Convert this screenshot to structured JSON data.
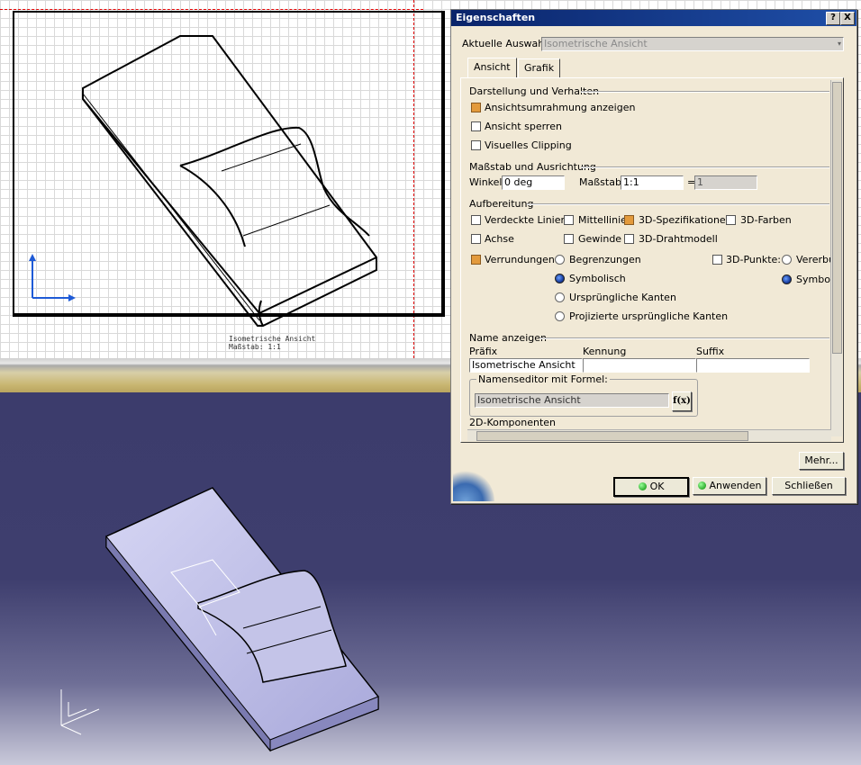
{
  "drawing": {
    "caption_line1": "Isometrische Ansicht",
    "caption_line2": "Maßstab:  1:1"
  },
  "dialog": {
    "title": "Eigenschaften",
    "help_button": "?",
    "close_button": "X",
    "current_selection_label": "Aktuelle Auswahl:",
    "current_selection_value": "Isometrische Ansicht",
    "tabs": [
      "Ansicht",
      "Grafik"
    ],
    "groups": {
      "display": {
        "title": "Darstellung und Verhalten",
        "items": [
          {
            "label": "Ansichtsumrahmung anzeigen",
            "checked": true
          },
          {
            "label": "Ansicht sperren",
            "checked": false
          },
          {
            "label": "Visuelles Clipping",
            "checked": false
          }
        ]
      },
      "scale": {
        "title": "Maßstab und Ausrichtung",
        "angle_label": "Winkel:",
        "angle_value": "0 deg",
        "scale_label": "Maßstab:",
        "scale_value": "1:1",
        "equals": "=",
        "scale_result": "1"
      },
      "dressup": {
        "title": "Aufbereitung",
        "hidden_lines": "Verdeckte Linien",
        "center_line": "Mittellinie",
        "spec3d": "3D-Spezifikationen",
        "colors3d": "3D-Farben",
        "axis": "Achse",
        "thread": "Gewinde",
        "wireframe3d": "3D-Drahtmodell",
        "fillets": "Verrundungen:",
        "fillet_options": [
          "Begrenzungen",
          "Symbolisch",
          "Ursprüngliche Kanten",
          "Projizierte ursprüngliche Kanten"
        ],
        "fillet_selected": "Symbolisch",
        "points3d": "3D-Punkte:",
        "points_options": [
          "Vererbur",
          "Symbol"
        ],
        "points_selected": "Symbol"
      },
      "name": {
        "title": "Name anzeigen",
        "prefix_label": "Präfix",
        "id_label": "Kennung",
        "suffix_label": "Suffix",
        "prefix_value": "Isometrische Ansicht",
        "id_value": "",
        "suffix_value": "",
        "formula_editor_label": "Namenseditor mit Formel:",
        "formula_value": "Isometrische Ansicht",
        "formula_button": "f(x)"
      },
      "components": {
        "title": "2D-Komponenten"
      }
    },
    "buttons": {
      "more": "Mehr...",
      "ok": "OK",
      "apply": "Anwenden",
      "close": "Schließen"
    },
    "colors": {
      "title_bar": "#0a246a",
      "checkbox_on": "#e39a3c"
    }
  }
}
